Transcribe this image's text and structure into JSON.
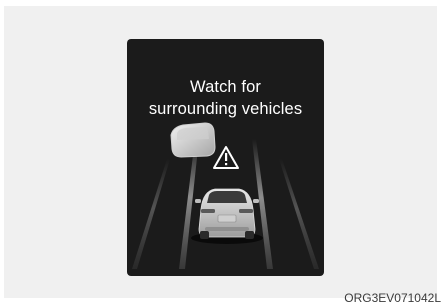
{
  "display": {
    "message_line1": "Watch for",
    "message_line2": "surrounding vehicles"
  },
  "icons": {
    "warning": "warning-triangle-icon",
    "surrounding_vehicle": "surrounding-vehicle-icon",
    "own_vehicle": "own-vehicle-icon"
  },
  "colors": {
    "screen_background": "#1b1b1b",
    "message_text": "#ffffff",
    "lane_lines": "#9a9a9a"
  },
  "figure_code": "ORG3EV071042L"
}
